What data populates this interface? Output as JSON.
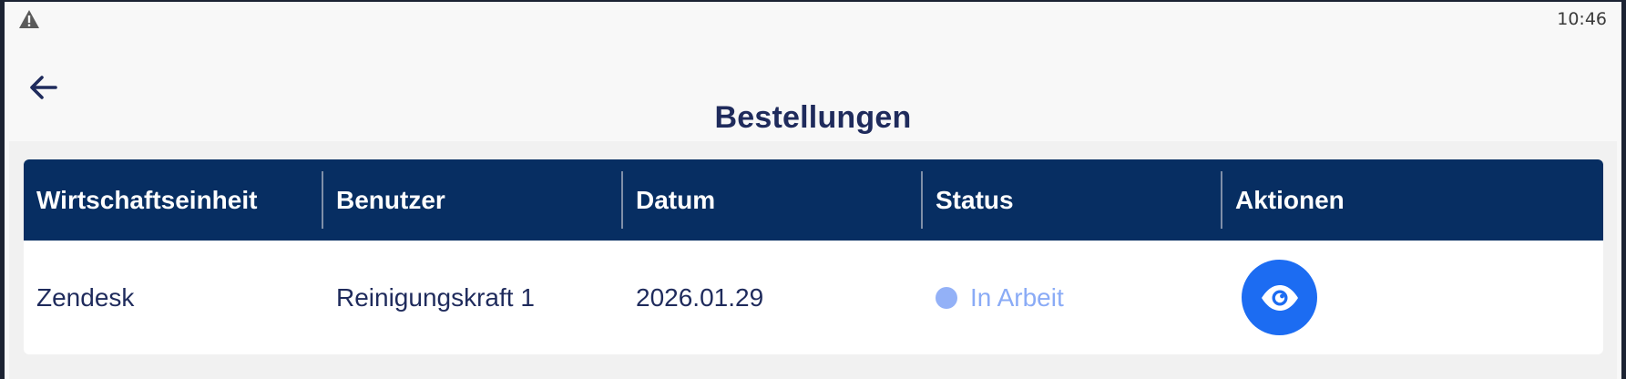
{
  "statusbar": {
    "time": "10:46",
    "warning_icon": "warning-icon"
  },
  "header": {
    "back_icon": "arrow-left-icon",
    "title": "Bestellungen"
  },
  "table": {
    "columns": [
      "Wirtschaftseinheit",
      "Benutzer",
      "Datum",
      "Status",
      "Aktionen"
    ],
    "rows": [
      {
        "unit": "Zendesk",
        "user": "Reinigungskraft 1",
        "date": "2026.01.29",
        "status": "In Arbeit",
        "status_color": "#93b1f7",
        "action_icon": "eye-icon"
      }
    ]
  },
  "colors": {
    "header_bg": "#072e62",
    "title": "#1f2b5c",
    "action_button": "#1c6cf2"
  }
}
